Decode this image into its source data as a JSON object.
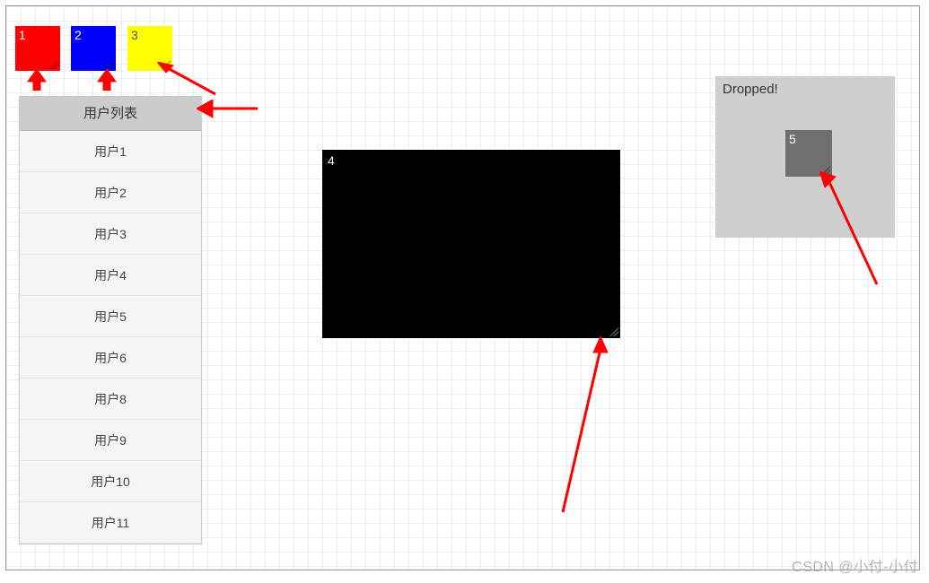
{
  "boxes": {
    "b1": {
      "label": "1",
      "color": "#ff0000"
    },
    "b2": {
      "label": "2",
      "color": "#0000ff"
    },
    "b3": {
      "label": "3",
      "color": "#ffff00"
    },
    "big": {
      "label": "4",
      "color": "#000000"
    },
    "b5": {
      "label": "5",
      "color": "#6f6f6f"
    }
  },
  "userPanel": {
    "header": "用户列表",
    "items": [
      "用户1",
      "用户2",
      "用户3",
      "用户4",
      "用户5",
      "用户6",
      "用户8",
      "用户9",
      "用户10",
      "用户11"
    ]
  },
  "dropZone": {
    "status": "Dropped!"
  },
  "watermark": "CSDN @小付-小付"
}
